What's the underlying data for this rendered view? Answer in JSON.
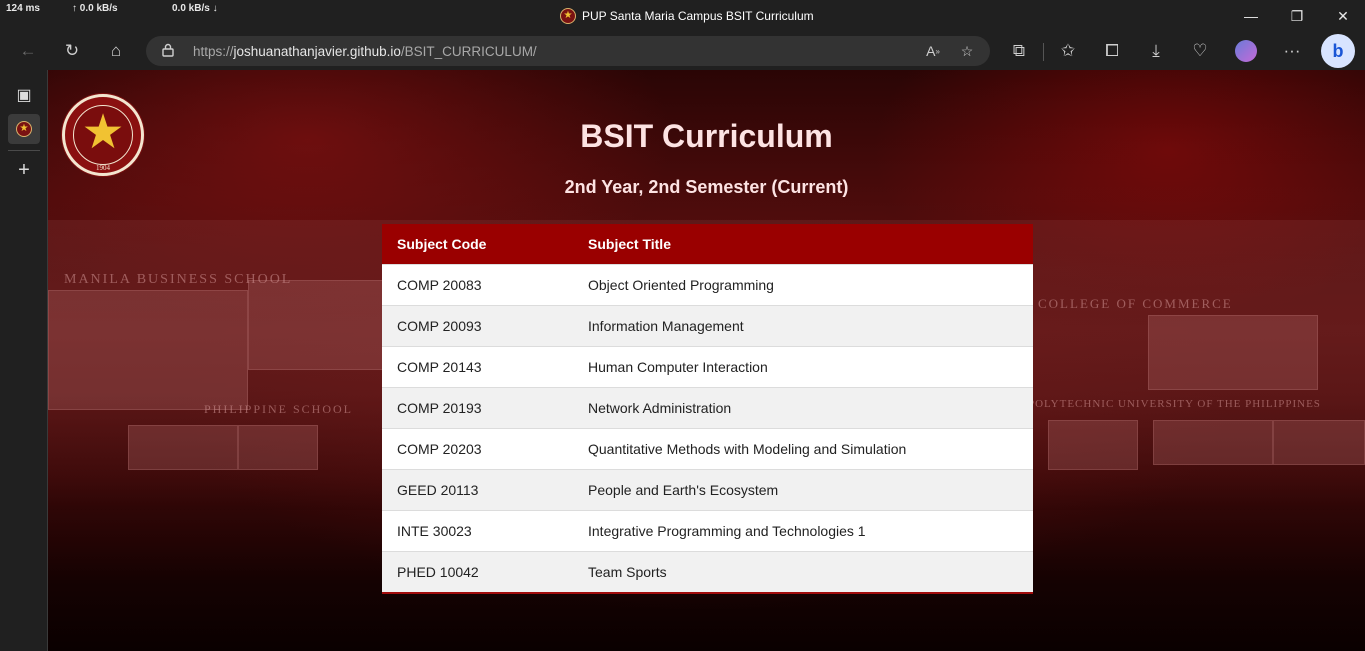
{
  "perf": {
    "latency": "124 ms",
    "up": "↑ 0.0 kB/s",
    "down": "0.0 kB/s ↓"
  },
  "window": {
    "title": "PUP Santa Maria Campus BSIT Curriculum"
  },
  "address_bar": {
    "url_prefix": "https://",
    "host": "joshuanathanjavier.github.io",
    "path": "/BSIT_CURRICULUM/"
  },
  "page": {
    "title": "BSIT Curriculum",
    "subtitle": "2nd Year, 2nd Semester (Current)",
    "logo_year": "1904",
    "logo_text": "POLYTECHNIC UNIVERSITY OF THE PHILIPPINES",
    "background_text": [
      "MANILA BUSINESS SCHOOL",
      "PHILIPPINE SCHOOL",
      "COLLEGE OF COMMERCE",
      "POLYTECHNIC UNIVERSITY OF THE PHILIPPINES"
    ]
  },
  "table": {
    "headers": [
      "Subject Code",
      "Subject Title"
    ],
    "rows": [
      [
        "COMP 20083",
        "Object Oriented Programming"
      ],
      [
        "COMP 20093",
        "Information Management"
      ],
      [
        "COMP 20143",
        "Human Computer Interaction"
      ],
      [
        "COMP 20193",
        "Network Administration"
      ],
      [
        "COMP 20203",
        "Quantitative Methods with Modeling and Simulation"
      ],
      [
        "GEED 20113",
        "People and Earth's Ecosystem"
      ],
      [
        "INTE 30023",
        "Integrative Programming and Technologies 1"
      ],
      [
        "PHED 10042",
        "Team Sports"
      ]
    ]
  },
  "colors": {
    "header_red": "#9a0000",
    "title_pink": "#fde3e3"
  }
}
